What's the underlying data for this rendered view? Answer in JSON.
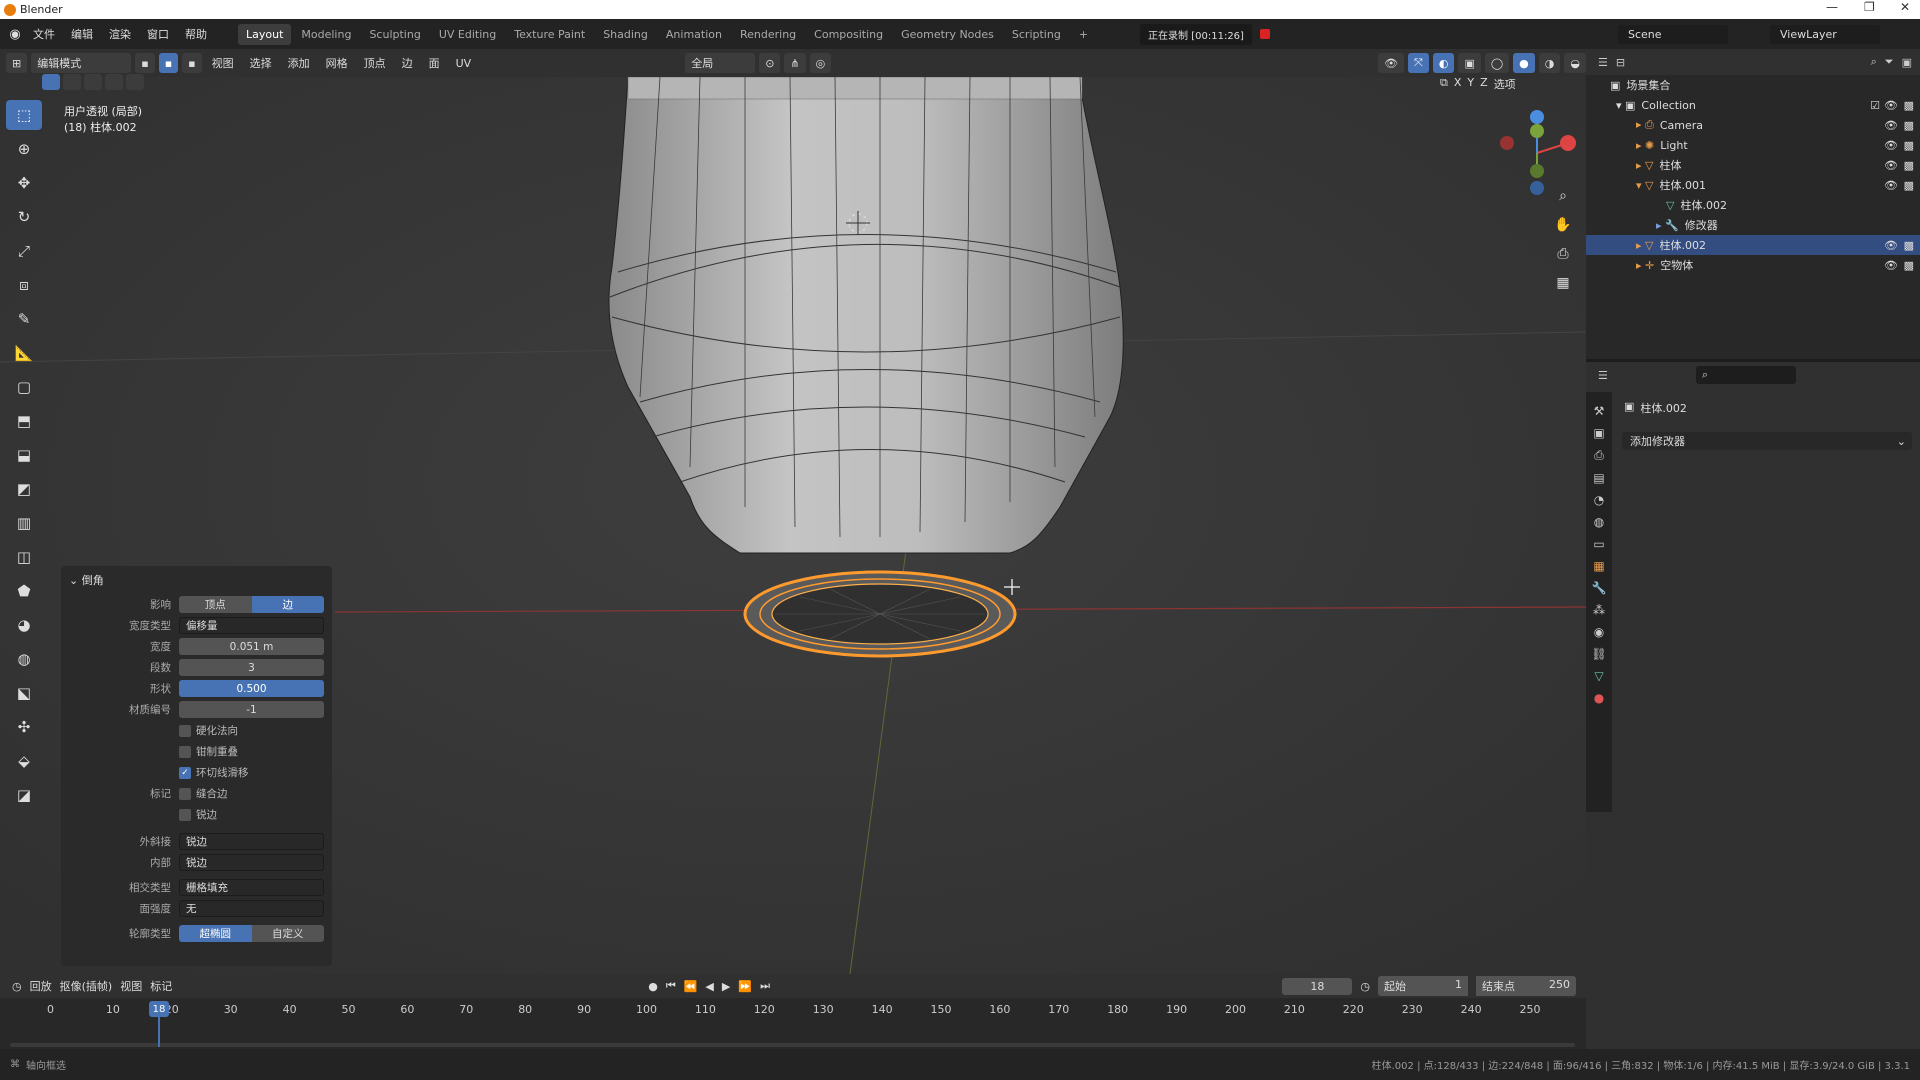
{
  "title_bar": {
    "app": "Blender",
    "min": "—",
    "max": "❐",
    "close": "✕"
  },
  "menu": [
    "文件",
    "编辑",
    "渲染",
    "窗口",
    "帮助"
  ],
  "workspaces": [
    "Layout",
    "Modeling",
    "Sculpting",
    "UV Editing",
    "Texture Paint",
    "Shading",
    "Animation",
    "Rendering",
    "Compositing",
    "Geometry Nodes",
    "Scripting",
    "+"
  ],
  "top_right": {
    "recording": "正在录制 [00:11:26]",
    "scene": "Scene",
    "view_layer": "ViewLayer"
  },
  "viewport_header": {
    "mode": "编辑模式",
    "menus": [
      "视图",
      "选择",
      "添加",
      "网格",
      "顶点",
      "边",
      "面",
      "UV"
    ],
    "transform_orientation": "全局",
    "axes": [
      "X",
      "Y",
      "Z"
    ],
    "options": "选项"
  },
  "viewport_info": {
    "view": "用户透视 (局部)",
    "object": "(18) 柱体.002"
  },
  "bevel_panel": {
    "title": "倒角",
    "affect_label": "影响",
    "affect_options": [
      "顶点",
      "边"
    ],
    "affect_selected": "边",
    "width_type_label": "宽度类型",
    "width_type": "偏移量",
    "width_label": "宽度",
    "width": "0.051 m",
    "segments_label": "段数",
    "segments": "3",
    "shape_label": "形状",
    "shape": "0.500",
    "material_label": "材质编号",
    "material": "-1",
    "harden_normals": "硬化法向",
    "clamp_overlap": "钳制重叠",
    "loop_slide": "环切线滑移",
    "mark_label": "标记",
    "mark_seam": "缝合边",
    "mark_sharp": "锐边",
    "outer_label": "外斜接",
    "outer": "锐边",
    "inner_label": "内部",
    "inner": "锐边",
    "intersection_label": "相交类型",
    "intersection": "栅格填充",
    "face_strength_label": "面强度",
    "face_strength": "无",
    "profile_label": "轮廓类型",
    "profile_options": [
      "超椭圆",
      "自定义"
    ],
    "profile_selected": "超椭圆",
    "checks": {
      "harden_normals": false,
      "clamp_overlap": false,
      "loop_slide": true,
      "mark_seam": false,
      "mark_sharp": false
    }
  },
  "outliner": {
    "header": "场景集合",
    "items": [
      {
        "label": "Collection",
        "indent": 1
      },
      {
        "label": "Camera",
        "indent": 2
      },
      {
        "label": "Light",
        "indent": 2
      },
      {
        "label": "柱体",
        "indent": 2
      },
      {
        "label": "柱体.001",
        "indent": 2
      },
      {
        "label": "柱体.002",
        "indent": 3
      },
      {
        "label": "修改器",
        "indent": 3
      },
      {
        "label": "柱体.002",
        "indent": 2,
        "selected": true
      },
      {
        "label": "空物体",
        "indent": 2
      }
    ]
  },
  "properties": {
    "object": "柱体.002",
    "add_modifier": "添加修改器"
  },
  "timeline": {
    "menus": [
      "回放",
      "抠像(插帧)",
      "视图",
      "标记"
    ],
    "current_frame": "18",
    "start_label": "起始",
    "start": "1",
    "end_label": "结束点",
    "end": "250",
    "ticks": [
      "0",
      "10",
      "20",
      "30",
      "40",
      "50",
      "60",
      "70",
      "80",
      "90",
      "100",
      "110",
      "120",
      "130",
      "140",
      "150",
      "160",
      "170",
      "180",
      "190",
      "200",
      "210",
      "220",
      "230",
      "240",
      "250"
    ]
  },
  "status": {
    "left": "轴向框选",
    "right": "柱体.002 | 点:128/433 | 边:224/848 | 面:96/416 | 三角:832 | 物体:1/6 | 内存:41.5 MiB | 显存:3.9/24.0 GiB | 3.3.1"
  },
  "colors": {
    "accent": "#4772b3",
    "selection": "#ff9a2e",
    "viewport_bg": "#393939"
  }
}
